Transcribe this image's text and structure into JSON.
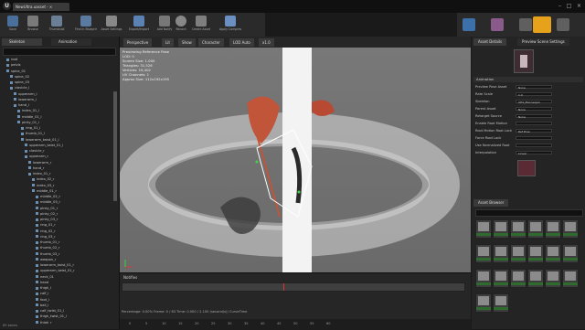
{
  "window": {
    "logo": "U",
    "doc_tab": "NewUltra.uasset - ×",
    "controls": [
      "–",
      "□",
      "×"
    ]
  },
  "toolbar": {
    "buttons": [
      {
        "label": "Save",
        "icon": "save-icon"
      },
      {
        "label": "Browse",
        "icon": "folder-icon"
      },
      {
        "label": "Thumbnail",
        "icon": "camera-icon"
      },
      {
        "label": "Find in Blueprints",
        "icon": "binoculars-icon"
      },
      {
        "label": "Asset Settings",
        "icon": "gear-icon"
      },
      {
        "label": "Export/Import",
        "icon": "export-icon"
      },
      {
        "label": "Add Notify",
        "icon": "plus-icon"
      },
      {
        "label": "Record",
        "icon": "record-icon"
      },
      {
        "label": "Create Asset",
        "icon": "create-icon"
      },
      {
        "label": "Apply Compression",
        "icon": "apply-icon"
      }
    ]
  },
  "left_panel": {
    "tabs": [
      "Skeleton",
      "Animation"
    ],
    "search_placeholder": "",
    "tree": [
      "root",
      "pelvis",
      "spine_01",
      "spine_02",
      "spine_03",
      "clavicle_l",
      "upperarm_l",
      "lowerarm_l",
      "hand_l",
      "index_01_l",
      "middle_01_l",
      "pinky_01_l",
      "ring_01_l",
      "thumb_01_l",
      "lowerarm_twist_01_l",
      "upperarm_twist_01_l",
      "clavicle_r",
      "upperarm_r",
      "lowerarm_r",
      "hand_r",
      "index_01_r",
      "index_02_r",
      "index_03_r",
      "middle_01_r",
      "middle_02_r",
      "middle_03_r",
      "pinky_01_r",
      "pinky_02_r",
      "pinky_03_r",
      "ring_01_r",
      "ring_02_r",
      "ring_03_r",
      "thumb_01_r",
      "thumb_02_r",
      "thumb_03_r",
      "weapon_r",
      "lowerarm_twist_01_r",
      "upperarm_twist_01_r",
      "neck_01",
      "head",
      "thigh_l",
      "calf_l",
      "foot_l",
      "ball_l",
      "calf_twist_01_l",
      "thigh_twist_01_l",
      "thigh_r",
      "calf_r"
    ],
    "status": "89 bones"
  },
  "viewport": {
    "tabs": [
      "Perspective",
      "Lit",
      "Show",
      "Character",
      "LOD Auto",
      "x1.0"
    ],
    "info_lines": [
      "Previewing Reference Pose",
      "LOD: 0",
      "Screen Size: 1.000",
      "Triangles: 31,526",
      "Vertices: 19,402",
      "UV Channels: 1",
      "Approx Size: 112x192x195"
    ]
  },
  "right_panel": {
    "tabs": [
      "Asset Details",
      "Preview Scene Settings"
    ],
    "section_label": "Animation",
    "props": [
      {
        "label": "Preview Pose Asset",
        "value": "None"
      },
      {
        "label": "Rate Scale",
        "value": "1.0"
      },
      {
        "label": "Skeleton",
        "value": "UE4_Mannequin"
      },
      {
        "label": "Parent Asset",
        "value": "None"
      },
      {
        "label": "Retarget Source",
        "value": "None"
      },
      {
        "label": "Enable Root Motion",
        "value": ""
      },
      {
        "label": "Root Motion Root Lock",
        "value": "Ref Pose"
      },
      {
        "label": "Force Root Lock",
        "value": ""
      },
      {
        "label": "Use Normalized Root",
        "value": ""
      },
      {
        "label": "Interpolation",
        "value": "Linear"
      }
    ],
    "asset_browser_tab": "Asset Browser",
    "thumb_count": 20
  },
  "sequencer": {
    "track_label": "Notifies",
    "status": "Percentage: 0.00%  Frame: 0 / 63  Time: 0.000 / 2.100 (second(s))  CurveTime",
    "frames": [
      "0",
      "5",
      "10",
      "15",
      "20",
      "25",
      "30",
      "35",
      "40",
      "45",
      "50",
      "55",
      "60"
    ]
  },
  "colors": {
    "accent": "#e6a21a",
    "viewport_bg": "#6e6e6e",
    "ring": "#ffffff",
    "weapon_red": "#c0553a"
  }
}
